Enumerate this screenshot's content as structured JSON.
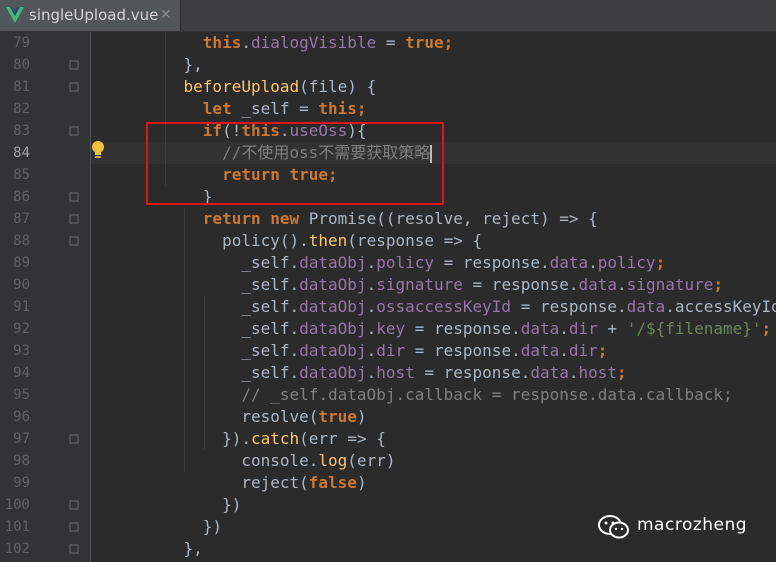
{
  "tab": {
    "filename": "singleUpload.vue",
    "close": "✕"
  },
  "watermark": {
    "text": "macrozheng"
  },
  "lines": [
    {
      "n": "79",
      "t": [
        [
          "      ",
          "pl"
        ],
        [
          "this",
          "kw"
        ],
        [
          ".",
          "pl"
        ],
        [
          "dialogVisible",
          "pu"
        ],
        [
          " = ",
          "pl"
        ],
        [
          "true",
          "kw"
        ],
        [
          ";",
          "kw"
        ]
      ]
    },
    {
      "n": "80",
      "t": [
        [
          "    },",
          "pl"
        ]
      ]
    },
    {
      "n": "81",
      "t": [
        [
          "    ",
          "pl"
        ],
        [
          "beforeUpload",
          "fn"
        ],
        [
          "(",
          "pl"
        ],
        [
          "file",
          "pl"
        ],
        [
          ") {",
          "pl"
        ]
      ]
    },
    {
      "n": "82",
      "t": [
        [
          "      ",
          "pl"
        ],
        [
          "let ",
          "kw"
        ],
        [
          "_self = ",
          "pl"
        ],
        [
          "this",
          "kw"
        ],
        [
          ";",
          "kw"
        ]
      ]
    },
    {
      "n": "83",
      "t": [
        [
          "      ",
          "pl"
        ],
        [
          "if",
          "kw"
        ],
        [
          "(!",
          "pl"
        ],
        [
          "this",
          "kw"
        ],
        [
          ".",
          "pl"
        ],
        [
          "useOss",
          "pu"
        ],
        [
          "){",
          "pl"
        ]
      ]
    },
    {
      "n": "84",
      "t": [
        [
          "        ",
          "pl"
        ],
        [
          "//不使用oss不需要获取策略",
          "cm"
        ]
      ]
    },
    {
      "n": "85",
      "t": [
        [
          "        ",
          "pl"
        ],
        [
          "return ",
          "kw"
        ],
        [
          "true",
          "kw"
        ],
        [
          ";",
          "kw"
        ]
      ]
    },
    {
      "n": "86",
      "t": [
        [
          "      }",
          "pl"
        ]
      ]
    },
    {
      "n": "87",
      "t": [
        [
          "      ",
          "pl"
        ],
        [
          "return ",
          "kw"
        ],
        [
          "new ",
          "kw"
        ],
        [
          "Promise((resolve, reject) => {",
          "pl"
        ]
      ]
    },
    {
      "n": "88",
      "t": [
        [
          "        policy().",
          "pl"
        ],
        [
          "then",
          "fn"
        ],
        [
          "(response => {",
          "pl"
        ]
      ]
    },
    {
      "n": "89",
      "t": [
        [
          "          _self.",
          "pl"
        ],
        [
          "dataObj",
          "pu"
        ],
        [
          ".",
          "pl"
        ],
        [
          "policy",
          "pu"
        ],
        [
          " = response.",
          "pl"
        ],
        [
          "data",
          "pu"
        ],
        [
          ".",
          "pl"
        ],
        [
          "policy",
          "pu"
        ],
        [
          ";",
          "kw"
        ]
      ]
    },
    {
      "n": "90",
      "t": [
        [
          "          _self.",
          "pl"
        ],
        [
          "dataObj",
          "pu"
        ],
        [
          ".",
          "pl"
        ],
        [
          "signature",
          "pu"
        ],
        [
          " = response.",
          "pl"
        ],
        [
          "data",
          "pu"
        ],
        [
          ".",
          "pl"
        ],
        [
          "signature",
          "pu"
        ],
        [
          ";",
          "kw"
        ]
      ]
    },
    {
      "n": "91",
      "t": [
        [
          "          _self.",
          "pl"
        ],
        [
          "dataObj",
          "pu"
        ],
        [
          ".",
          "pl"
        ],
        [
          "ossaccessKeyId",
          "pu"
        ],
        [
          " = response.",
          "pl"
        ],
        [
          "data",
          "pu"
        ],
        [
          ".",
          "pl"
        ],
        [
          "accessKeyId",
          "pl"
        ],
        [
          ";",
          "kw"
        ]
      ]
    },
    {
      "n": "92",
      "t": [
        [
          "          _self.",
          "pl"
        ],
        [
          "dataObj",
          "pu"
        ],
        [
          ".",
          "pl"
        ],
        [
          "key",
          "pu"
        ],
        [
          " = response.",
          "pl"
        ],
        [
          "data",
          "pu"
        ],
        [
          ".",
          "pl"
        ],
        [
          "dir",
          "pu"
        ],
        [
          " + ",
          "pl"
        ],
        [
          "'/${filename}'",
          "st"
        ],
        [
          ";",
          "kw"
        ]
      ]
    },
    {
      "n": "93",
      "t": [
        [
          "          _self.",
          "pl"
        ],
        [
          "dataObj",
          "pu"
        ],
        [
          ".",
          "pl"
        ],
        [
          "dir",
          "pu"
        ],
        [
          " = response.",
          "pl"
        ],
        [
          "data",
          "pu"
        ],
        [
          ".",
          "pl"
        ],
        [
          "dir",
          "pu"
        ],
        [
          ";",
          "kw"
        ]
      ]
    },
    {
      "n": "94",
      "t": [
        [
          "          _self.",
          "pl"
        ],
        [
          "dataObj",
          "pu"
        ],
        [
          ".",
          "pl"
        ],
        [
          "host",
          "pu"
        ],
        [
          " = response.",
          "pl"
        ],
        [
          "data",
          "pu"
        ],
        [
          ".",
          "pl"
        ],
        [
          "host",
          "pu"
        ],
        [
          ";",
          "kw"
        ]
      ]
    },
    {
      "n": "95",
      "t": [
        [
          "          ",
          "pl"
        ],
        [
          "// _self.dataObj.callback = response.data.callback;",
          "cm"
        ]
      ]
    },
    {
      "n": "96",
      "t": [
        [
          "          resolve(",
          "pl"
        ],
        [
          "true",
          "kw"
        ],
        [
          ")",
          "pl"
        ]
      ]
    },
    {
      "n": "97",
      "t": [
        [
          "        }).",
          "pl"
        ],
        [
          "catch",
          "fn"
        ],
        [
          "(err => {",
          "pl"
        ]
      ]
    },
    {
      "n": "98",
      "t": [
        [
          "          console.",
          "pl"
        ],
        [
          "log",
          "fn"
        ],
        [
          "(err)",
          "pl"
        ]
      ]
    },
    {
      "n": "99",
      "t": [
        [
          "          reject(",
          "pl"
        ],
        [
          "false",
          "kw"
        ],
        [
          ")",
          "pl"
        ]
      ]
    },
    {
      "n": "100",
      "t": [
        [
          "        })",
          "pl"
        ]
      ]
    },
    {
      "n": "101",
      "t": [
        [
          "      })",
          "pl"
        ]
      ]
    },
    {
      "n": "102",
      "t": [
        [
          "    },",
          "pl"
        ]
      ]
    }
  ]
}
